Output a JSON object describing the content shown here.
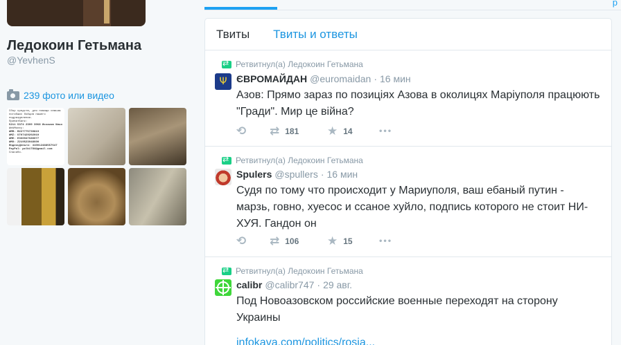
{
  "profile": {
    "name": "Ледокоин Гетьмана",
    "handle": "@YevhenS",
    "media_label": "239 фото или видео",
    "donation_note": {
      "heading": "Сбор средств, для помощи семьям погибших бойцов нашего подразделения.",
      "privat_label": "ПриватБанк:",
      "privat_card": "5211 5374 2399 3968 Исхаков Илья",
      "webmoney_label": "WebMoney:",
      "wmr": "WMR: R227775739819",
      "wmz": "WMZ: U707429202010",
      "wme": "WME: E360947680077",
      "wmu": "WMU: Z219523948600",
      "yandex": "ЯндексДеньги: 410012488557647",
      "paypal": "PayPal: polk1784@gmail.com",
      "thanks": "Спасибо."
    }
  },
  "tabs": {
    "tweets": "Твиты",
    "tweets_replies": "Твиты и ответы"
  },
  "tweets": [
    {
      "retweet_label": "Ретвитнул(а) Ледокоин Гетьмана",
      "name": "ЄВРОМАЙДАН",
      "username": "@euromaidan",
      "dot": "·",
      "time": "16 мин",
      "text": "Азов: Прямо зараз по позиціях Азова в околицях Маріуполя працюють \"Гради\". Мир це війна?",
      "retweets": "181",
      "favorites": "14"
    },
    {
      "retweet_label": "Ретвитнул(а) Ледокоин Гетьмана",
      "name": "Spulers",
      "username": "@spullers",
      "dot": "·",
      "time": "16 мин",
      "text": "Судя по тому что происходит у Мариуполя, ваш ебаный путин - марзь, говно, хуесос и ссаное хуйло, подпись которого не стоит НИ-ХУЯ. Гандон он",
      "retweets": "106",
      "favorites": "15"
    },
    {
      "retweet_label": "Ретвитнул(а) Ледокоин Гетьмана",
      "name": "calibr",
      "username": "@calibr747",
      "dot": "·",
      "time": "29 авг.",
      "text": "Под Новоазовском российские военные переходят на сторону Украины",
      "link": "infokava.com/politics/rosia..."
    }
  ],
  "glyphs": {
    "reply": "⟲",
    "retweet": "⇄",
    "favorite": "★",
    "more": "•••",
    "trident": "Ψ",
    "corner": "р"
  }
}
